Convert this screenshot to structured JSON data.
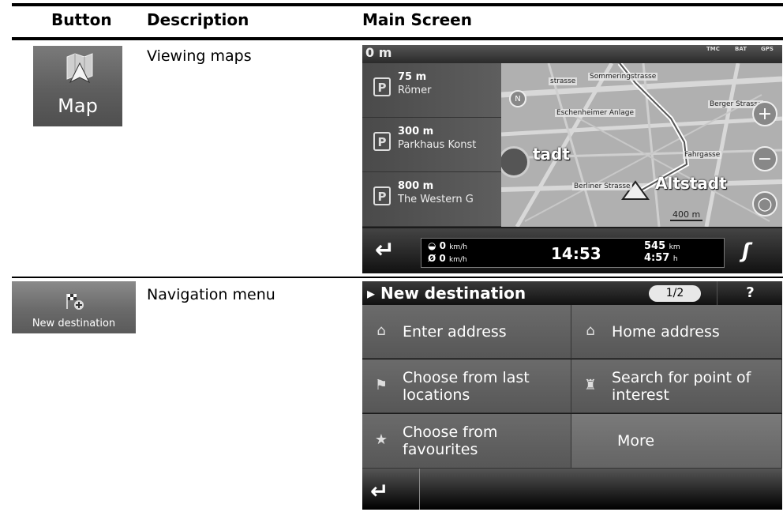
{
  "table": {
    "headers": {
      "button": "Button",
      "description": "Description",
      "main_screen": "Main Screen"
    }
  },
  "rows": [
    {
      "button_label": "Map",
      "button_icon": "map-icon",
      "description": "Viewing maps"
    },
    {
      "button_label": "New destination",
      "button_icon": "checkered-flag-plus-icon",
      "description": "Navigation menu"
    }
  ],
  "map_screen": {
    "distance_top": "0 m",
    "status": {
      "tmc": "TMC",
      "bat": "BAT",
      "gps": "GPS"
    },
    "parking": [
      {
        "distance": "75 m",
        "name": "Römer"
      },
      {
        "distance": "300 m",
        "name": "Parkhaus Konst"
      },
      {
        "distance": "800 m",
        "name": "The Western G"
      }
    ],
    "streets": [
      "Sommeringstrasse",
      "Eschenheimer Anlage",
      "Berger Strasse",
      "Fahrgasse",
      "Berliner Strasse",
      "strasse"
    ],
    "places": [
      "tadt",
      "Altstadt"
    ],
    "scale": "400 m",
    "speed_current": "0",
    "speed_avg": "0",
    "speed_unit": "km/h",
    "avg_symbol": "Ø",
    "clock": "14:53",
    "remaining_distance": "545",
    "remaining_distance_unit": "km",
    "remaining_time": "4:57",
    "remaining_time_unit": "h"
  },
  "menu_screen": {
    "title": "New destination",
    "page": "1/2",
    "help": "?",
    "items": [
      {
        "label_line1": "Enter address",
        "label_line2": "",
        "icon": "house-magnifier-icon"
      },
      {
        "label_line1": "Home address",
        "label_line2": "",
        "icon": "home-icon"
      },
      {
        "label_line1": "Choose from last",
        "label_line2": "locations",
        "icon": "recent-flag-icon"
      },
      {
        "label_line1": "Search for point of",
        "label_line2": "interest",
        "icon": "castle-icon"
      },
      {
        "label_line1": "Choose from",
        "label_line2": "favourites",
        "icon": "star-icon"
      },
      {
        "label_line1": "More",
        "label_line2": "",
        "icon": ""
      }
    ]
  }
}
